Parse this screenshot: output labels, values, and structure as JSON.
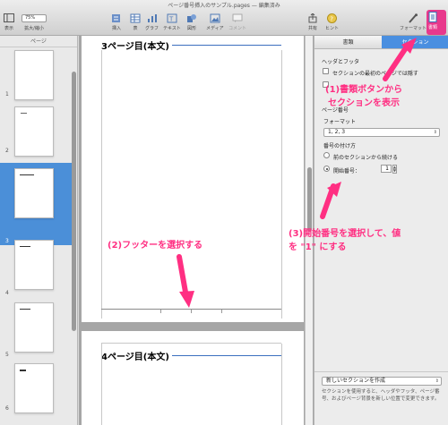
{
  "window": {
    "title": "ページ番号挿入のサンプル.pages — 編集済み"
  },
  "toolbar": {
    "view_label": "表示",
    "zoom_value": "75%",
    "zoom_label": "拡大/縮小",
    "items": [
      {
        "label": "挿入",
        "icon": "insert-icon"
      },
      {
        "label": "表",
        "icon": "table-icon"
      },
      {
        "label": "グラフ",
        "icon": "chart-icon"
      },
      {
        "label": "テキスト",
        "icon": "text-icon"
      },
      {
        "label": "図形",
        "icon": "shape-icon"
      },
      {
        "label": "メディア",
        "icon": "media-icon"
      },
      {
        "label": "コメント",
        "icon": "comment-icon"
      }
    ],
    "share_label": "共有",
    "tips_label": "ヒント",
    "format_label": "フォーマット",
    "document_label": "書類"
  },
  "sidebar": {
    "header": "ページ",
    "pages": [
      "1",
      "2",
      "3",
      "4",
      "5",
      "6"
    ],
    "selected_page": "3"
  },
  "canvas": {
    "page3_heading": "3ページ目(本文)",
    "page4_heading": "4ページ目(本文)"
  },
  "inspector": {
    "tabs": [
      "書類",
      "セクション"
    ],
    "active_tab": "セクション",
    "header_footer_label": "ヘッダとフッタ",
    "hide_on_first_label": "セクションの最初のページでは隠す",
    "page_number_label": "ページ番号",
    "format_label": "フォーマット",
    "format_value": "1, 2, 3",
    "numbering_label": "番号の付け方",
    "continue_label": "前のセクションから続ける",
    "start_at_label": "開始番号：",
    "start_at_value": "1",
    "new_section_button": "新しいセクションを作成",
    "hint_text": "セクションを使用すると、ヘッダやフッタ、ページ番号、およびページ背景を新しい位置で変更できます。"
  },
  "annotations": {
    "step1_line1": "(1)書類ボタンから",
    "step1_line2": "セクションを表示",
    "step2": "(2)フッターを選択する",
    "step3_line1": "(3)開始番号を選択して、値",
    "step3_line2": "を \"1\" にする"
  },
  "colors": {
    "accent": "#ff2f82",
    "selection_blue": "#4a8fe0",
    "heading_rule": "#3c6fbf"
  }
}
